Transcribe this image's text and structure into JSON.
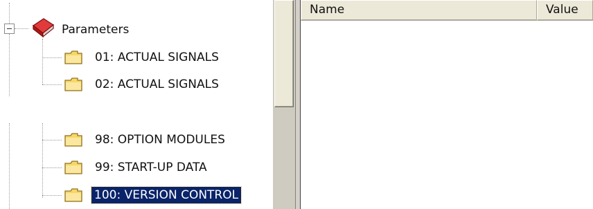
{
  "tree": {
    "root": {
      "label": "Parameters",
      "icon": "book-icon",
      "expander_icon": "minus-box-icon"
    },
    "items": [
      {
        "label": "01: ACTUAL SIGNALS",
        "icon": "folder-icon",
        "selected": false
      },
      {
        "label": "02: ACTUAL SIGNALS",
        "icon": "folder-icon",
        "selected": false
      },
      {
        "label": "98: OPTION MODULES",
        "icon": "folder-icon",
        "selected": false
      },
      {
        "label": "99: START-UP DATA",
        "icon": "folder-icon",
        "selected": false
      },
      {
        "label": "100: VERSION CONTROL",
        "icon": "folder-icon",
        "selected": true
      }
    ]
  },
  "listview": {
    "columns": [
      "Name",
      "Value"
    ],
    "rows": []
  },
  "colors": {
    "selection_bg": "#0a246a",
    "selection_text": "#ffffff",
    "folder": "#f5d36b",
    "book": "#cc1f1f"
  }
}
